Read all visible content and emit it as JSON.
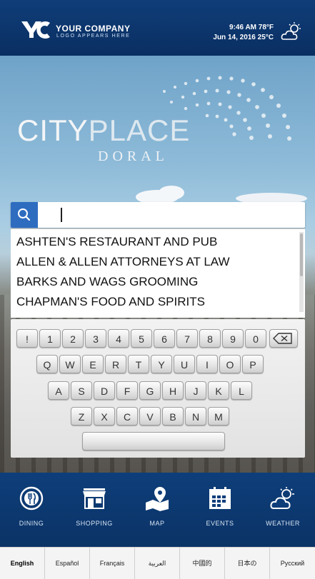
{
  "header": {
    "company_name": "YOUR COMPANY",
    "company_sub": "LOGO APPEARS HERE",
    "time_temp": "9:46 AM 78°F",
    "date_temp": "Jun 14, 2016 25°C",
    "weather_icon": "cloud-sun-icon"
  },
  "brand": {
    "city": "CITY",
    "place": "PLACE",
    "doral": "DORAL"
  },
  "search": {
    "value": "",
    "placeholder": ""
  },
  "results": [
    "ASHTEN'S RESTAURANT AND PUB",
    "ALLEN & ALLEN ATTORNEYS AT LAW",
    "BARKS AND WAGS GROOMING",
    "CHAPMAN'S FOOD AND SPIRITS"
  ],
  "keyboard": {
    "row1": [
      "!",
      "1",
      "2",
      "3",
      "4",
      "5",
      "6",
      "7",
      "8",
      "9",
      "0"
    ],
    "row2": [
      "Q",
      "W",
      "E",
      "R",
      "T",
      "Y",
      "U",
      "I",
      "O",
      "P"
    ],
    "row3": [
      "A",
      "S",
      "D",
      "F",
      "G",
      "H",
      "J",
      "K",
      "L"
    ],
    "row4": [
      "Z",
      "X",
      "C",
      "V",
      "B",
      "N",
      "M"
    ],
    "backspace_icon": "backspace-icon",
    "space_label": ""
  },
  "nav": {
    "items": [
      {
        "label": "DINING",
        "icon": "dining-icon"
      },
      {
        "label": "SHOPPING",
        "icon": "store-icon"
      },
      {
        "label": "MAP",
        "icon": "map-pin-icon"
      },
      {
        "label": "EVENTS",
        "icon": "calendar-icon"
      },
      {
        "label": "WEATHER",
        "icon": "cloud-sun-icon"
      }
    ]
  },
  "languages": [
    "English",
    "Español",
    "Français",
    "العربية",
    "中國的",
    "日本の",
    "Русский"
  ],
  "colors": {
    "header_blue": "#0f3d78",
    "search_blue": "#2e6cc0",
    "nav_blue": "#0e3e7a"
  }
}
